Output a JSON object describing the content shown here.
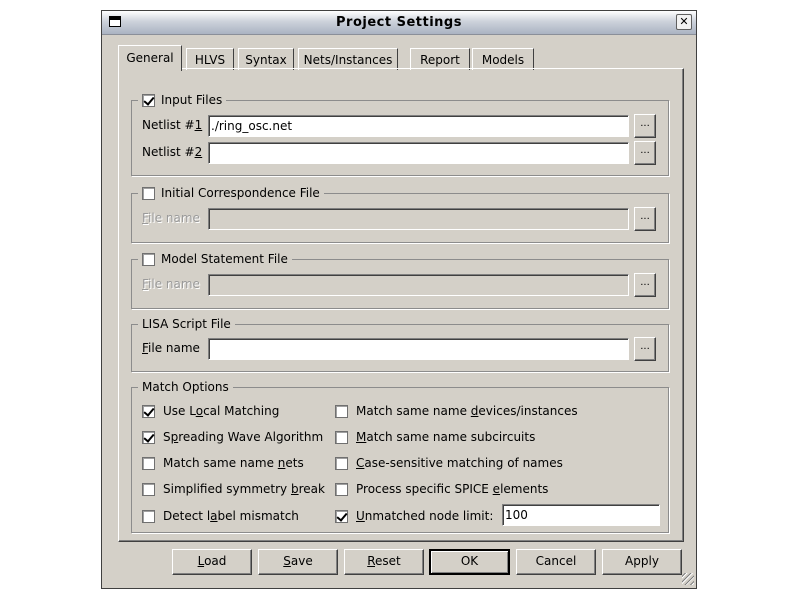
{
  "window": {
    "title": "Project Settings"
  },
  "tabs": [
    "General",
    "HLVS",
    "Syntax",
    "Nets/Instances",
    "Report",
    "Models"
  ],
  "input_files": {
    "legend": "Input Files",
    "checked": true,
    "netlist1": {
      "label_pre": "Netlist #",
      "label_key": "1",
      "value": "./ring_osc.net"
    },
    "netlist2": {
      "label_pre": "Netlist #",
      "label_key": "2",
      "value": ""
    },
    "browse_label": "..."
  },
  "initial_correspondence": {
    "legend": "Initial Correspondence File",
    "checked": false,
    "file_label_key": "F",
    "file_label_rest": "ile name",
    "value": ""
  },
  "model_statement": {
    "legend": "Model Statement File",
    "checked": false,
    "file_label_key": "F",
    "file_label_rest": "ile name",
    "value": ""
  },
  "lisa_script": {
    "legend": "LISA Script File",
    "file_label_key": "F",
    "file_label_rest": "ile name",
    "value": ""
  },
  "match_options": {
    "legend": "Match Options",
    "left": [
      {
        "pre": "Use L",
        "key": "o",
        "post": "cal Matching",
        "checked": true
      },
      {
        "pre": "S",
        "key": "p",
        "post": "reading Wave Algorithm",
        "checked": true
      },
      {
        "pre": "Match same name ",
        "key": "n",
        "post": "ets",
        "checked": false
      },
      {
        "pre": "Simplified symmetry ",
        "key": "b",
        "post": "reak",
        "checked": false
      },
      {
        "pre": "Detect l",
        "key": "a",
        "post": "bel mismatch",
        "checked": false
      }
    ],
    "right": [
      {
        "pre": "Match same name ",
        "key": "d",
        "post": "evices/instances",
        "checked": false
      },
      {
        "pre": "",
        "key": "M",
        "post": "atch same name subcircuits",
        "checked": false
      },
      {
        "pre": "",
        "key": "C",
        "post": "ase-sensitive matching of names",
        "checked": false
      },
      {
        "pre": "Process specific SPICE ",
        "key": "e",
        "post": "lements",
        "checked": false
      },
      {
        "pre": "",
        "key": "U",
        "post": "nmatched node limit:",
        "checked": true
      }
    ],
    "node_limit_value": "100"
  },
  "buttons": {
    "load_key": "L",
    "load_rest": "oad",
    "save_key": "S",
    "save_rest": "ave",
    "reset_key": "R",
    "reset_rest": "eset",
    "ok": "OK",
    "cancel": "Cancel",
    "apply": "Apply"
  }
}
